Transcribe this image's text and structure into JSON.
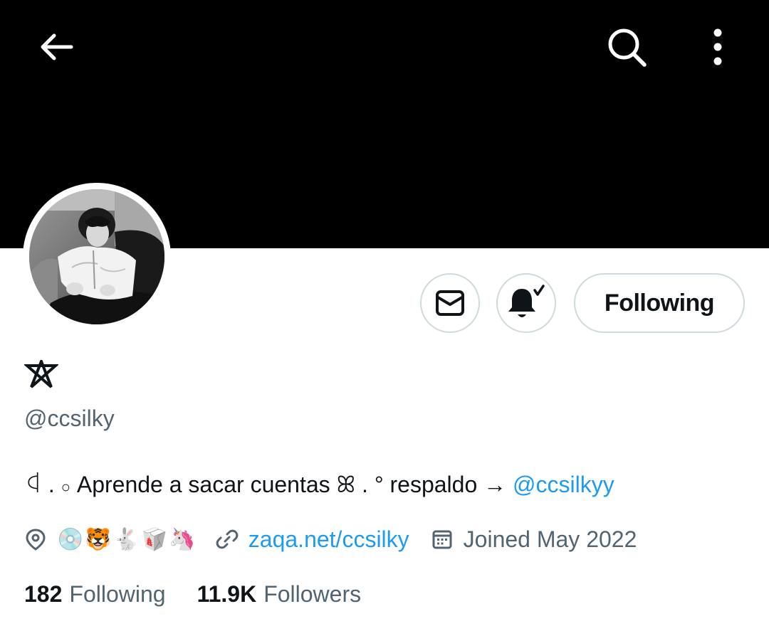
{
  "profile": {
    "display_name": "⛧",
    "handle": "@ccsilky",
    "bio": {
      "prefix": "ꒉ . ",
      "small_o": "○",
      "text": " Aprende a sacar cuentas ꕤ . ° respaldo → ",
      "mention": "@ccsilkyy"
    },
    "location": "💿🐯🐇🥡🦄",
    "website": "zaqa.net/ccsilky",
    "joined": "Joined May 2022"
  },
  "actions": {
    "follow_label": "Following"
  },
  "stats": {
    "following_count": "182",
    "following_label": "Following",
    "followers_count": "11.9K",
    "followers_label": "Followers"
  },
  "icons": {
    "back": "arrow-left-icon",
    "search": "search-icon",
    "more": "more-vertical-icon",
    "message": "envelope-icon",
    "notifications": "bell-check-icon",
    "location": "location-pin-icon",
    "link": "link-icon",
    "calendar": "calendar-icon"
  },
  "colors": {
    "banner": "#000000",
    "link": "#1d9bf0",
    "muted_text": "#536471",
    "primary_text": "#0f1419",
    "border": "#cfd9de"
  }
}
